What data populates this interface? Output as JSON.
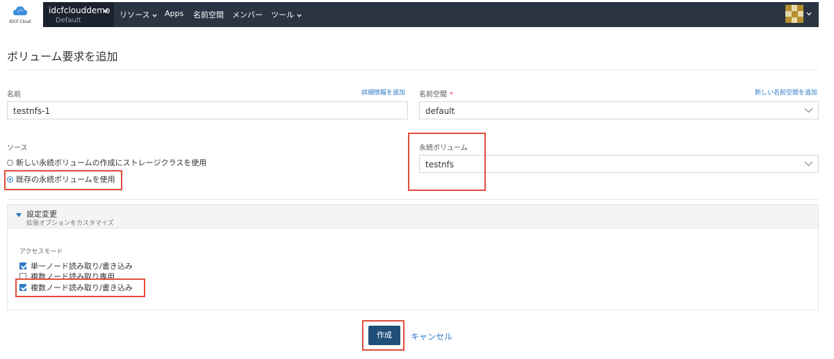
{
  "header": {
    "logo_text": "IDCF Cloud",
    "cluster_name": "idcfclouddemo",
    "cluster_project": "Default",
    "nav": [
      {
        "label": "リソース",
        "has_dropdown": true
      },
      {
        "label": "Apps",
        "has_dropdown": false
      },
      {
        "label": "名前空間",
        "has_dropdown": false
      },
      {
        "label": "メンバー",
        "has_dropdown": false
      },
      {
        "label": "ツール",
        "has_dropdown": true
      }
    ]
  },
  "page": {
    "title": "ボリューム要求を追加"
  },
  "form": {
    "name": {
      "label": "名前",
      "link": "詳細情報を追加",
      "value": "testnfs-1"
    },
    "namespace": {
      "label": "名前空間",
      "required_mark": "*",
      "link": "新しい名前空間を追加",
      "value": "default"
    },
    "source": {
      "label": "ソース",
      "options": [
        {
          "label": "新しい永続ボリュームの作成にストレージクラスを使用",
          "selected": false
        },
        {
          "label": "既存の永続ボリュームを使用",
          "selected": true
        }
      ]
    },
    "persistent_volume": {
      "label": "永続ボリューム",
      "value": "testnfs"
    }
  },
  "advanced": {
    "title": "設定変更",
    "subtitle": "拡張オプションをカスタマイズ",
    "access_mode_label": "アクセスモード",
    "access_modes": [
      {
        "label": "単一ノード読み取り/書き込み",
        "checked": true
      },
      {
        "label": "複数ノード読み取り専用",
        "checked": false
      },
      {
        "label": "複数ノード読み取り/書き込み",
        "checked": true
      }
    ]
  },
  "actions": {
    "create_label": "作成",
    "cancel_label": "キャンセル"
  },
  "colors": {
    "nav_bg": "#2b3442",
    "cluster_bg": "#1c222d",
    "primary": "#1f4e79",
    "link": "#2a7ac7",
    "highlight": "#e24a3b"
  }
}
